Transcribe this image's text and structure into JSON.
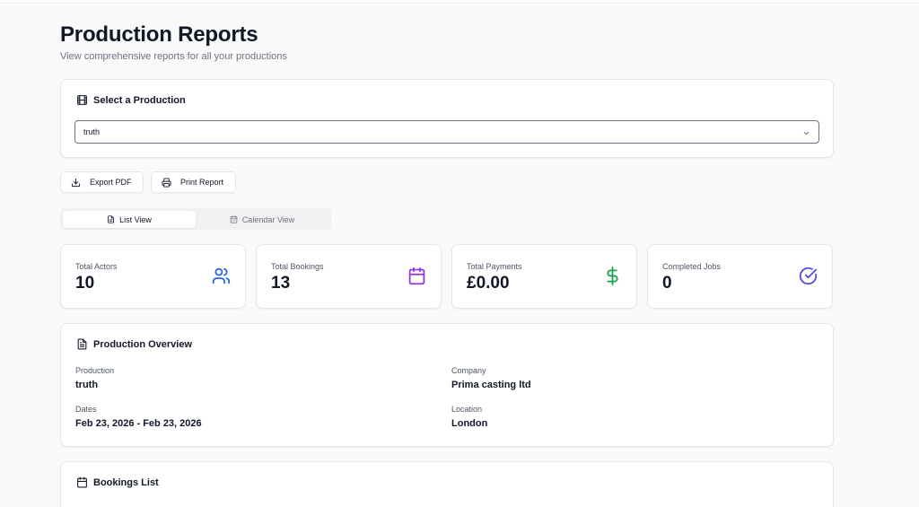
{
  "header": {
    "title": "Production Reports",
    "subtitle": "View comprehensive reports for all your productions"
  },
  "select_production": {
    "title": "Select a Production",
    "value": "truth",
    "icon": "film-icon"
  },
  "actions": {
    "export_label": "Export PDF",
    "print_label": "Print Report"
  },
  "view_tabs": {
    "list_label": "List View",
    "calendar_label": "Calendar View",
    "active": "List View"
  },
  "stats": [
    {
      "label": "Total Actors",
      "value": "10",
      "icon": "users-icon",
      "color": "#2563eb"
    },
    {
      "label": "Total Bookings",
      "value": "13",
      "icon": "calendar-icon",
      "color": "#9333ea"
    },
    {
      "label": "Total Payments",
      "value": "£0.00",
      "icon": "dollar-icon",
      "color": "#16a34a"
    },
    {
      "label": "Completed Jobs",
      "value": "0",
      "icon": "check-circle-icon",
      "color": "#4f46e5"
    }
  ],
  "overview": {
    "title": "Production Overview",
    "production_label": "Production",
    "production_value": "truth",
    "company_label": "Company",
    "company_value": "Prima casting ltd",
    "dates_label": "Dates",
    "dates_value": "Feb 23, 2026 - Feb 23, 2026",
    "location_label": "Location",
    "location_value": "London"
  },
  "bookings": {
    "title": "Bookings List"
  }
}
